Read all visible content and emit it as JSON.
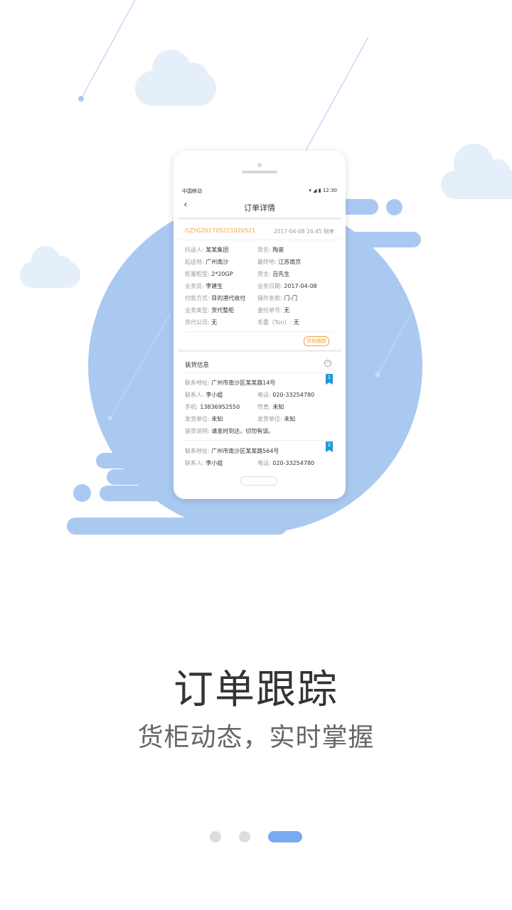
{
  "illustration": {
    "phone": {
      "status_bar": {
        "carrier": "中国移动",
        "time": "12:30"
      },
      "nav": {
        "back_icon": "chevron-left-icon",
        "title": "订单详情"
      },
      "order": {
        "number": "GZYG201705221020521",
        "date": "2017-04-08 16:45 制单",
        "fields": [
          {
            "label": "托运人:",
            "value": "某某集团"
          },
          {
            "label": "货名:",
            "value": "陶瓷"
          },
          {
            "label": "起运地:",
            "value": "广州南沙"
          },
          {
            "label": "最终地:",
            "value": "江苏南京"
          },
          {
            "label": "柜量柜型:",
            "value": "2*20GP"
          },
          {
            "label": "货主:",
            "value": "吕先生"
          },
          {
            "label": "业务员:",
            "value": "李建生"
          },
          {
            "label": "业务日期:",
            "value": "2017-04-08"
          },
          {
            "label": "付款方式:",
            "value": "目的港代收付"
          },
          {
            "label": "操作条款:",
            "value": "门-门"
          },
          {
            "label": "业务类型:",
            "value": "货代整柜"
          },
          {
            "label": "委托单号:",
            "value": "无"
          },
          {
            "label": "货代公司:",
            "value": "无"
          },
          {
            "label": "毛重（Ton）:",
            "value": "无"
          }
        ],
        "track_button": "货柜跟踪"
      },
      "loading": {
        "title": "装货信息",
        "collapse_icon": "chevron-up-circle-icon",
        "entries": [
          {
            "index": "1",
            "address_label": "联系地址:",
            "address": "广州市南沙区某某路14号",
            "contact_label": "联系人:",
            "contact": "李小姐",
            "phone_label": "电话:",
            "phone": "020-33254780",
            "mobile_label": "手机:",
            "mobile": "13836952550",
            "fax_label": "传真:",
            "fax": "未知",
            "shipper_label": "发货单位:",
            "shipper": "未知",
            "shipper2_label": "发货单位:",
            "shipper2": "未知",
            "note_label": "装货说明:",
            "note": "请准时到达，切勿有误。"
          },
          {
            "index": "2",
            "address_label": "联系地址:",
            "address": "广州市南沙区某某路564号",
            "contact_label": "联系人:",
            "contact": "李小姐",
            "phone_label": "电话:",
            "phone": "020-33254780"
          }
        ]
      }
    }
  },
  "heading": "订单跟踪",
  "subheading": "货柜动态，实时掌握",
  "pagination": {
    "count": 3,
    "active_index": 2
  },
  "colors": {
    "accent_blue": "#aac9f1",
    "cloud": "#e5effa",
    "orange": "#f0a040",
    "tag_blue": "#1d99d6",
    "dot_active": "#7aaaf0"
  }
}
